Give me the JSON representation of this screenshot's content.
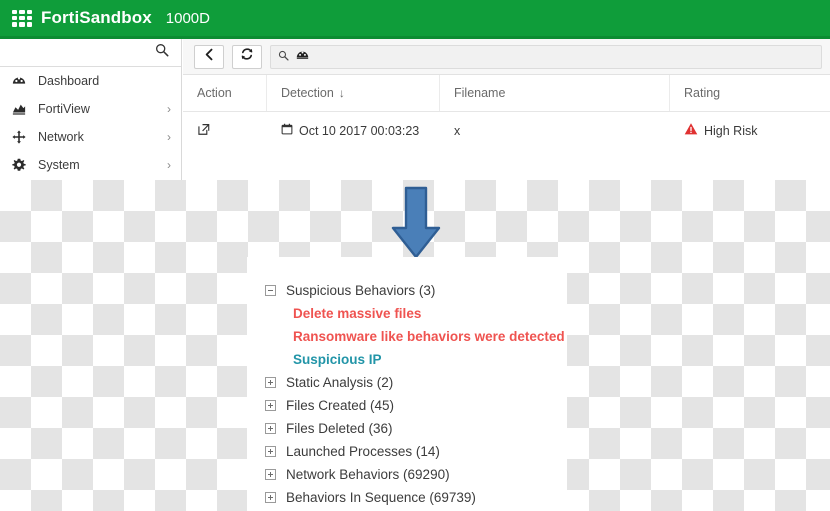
{
  "header": {
    "brand": "FortiSandbox",
    "model": "1000D",
    "logo_icon": "grid-logo-icon",
    "bg_color": "#0f9d3a"
  },
  "sidebar": {
    "search_icon": "search-icon",
    "items": [
      {
        "label": "Dashboard",
        "icon": "dashboard-gauge-icon",
        "chevron": ""
      },
      {
        "label": "FortiView",
        "icon": "area-chart-icon",
        "chevron": "›"
      },
      {
        "label": "Network",
        "icon": "move-arrows-icon",
        "chevron": "›"
      },
      {
        "label": "System",
        "icon": "gear-icon",
        "chevron": "›"
      }
    ]
  },
  "toolbar": {
    "back_icon": "chevron-left-icon",
    "refresh_icon": "refresh-icon",
    "search_icon": "search-icon",
    "filter_icon": "dashboard-gauge-icon",
    "search_value": "",
    "search_placeholder": ""
  },
  "table": {
    "columns": [
      {
        "key": "action",
        "label": "Action"
      },
      {
        "key": "detection",
        "label": "Detection",
        "sort": "↓"
      },
      {
        "key": "filename",
        "label": "Filename"
      },
      {
        "key": "rating",
        "label": "Rating"
      }
    ],
    "rows": [
      {
        "action_icon": "external-link-icon",
        "detection_icon": "calendar-icon",
        "detection": "Oct 10 2017 00:03:23",
        "filename": "x",
        "rating_icon": "warning-triangle-icon",
        "rating": "High Risk",
        "rating_color": "#e03131"
      }
    ]
  },
  "annotation": {
    "arrow_icon": "down-arrow-icon",
    "arrow_fill": "#4a7fb8",
    "arrow_stroke": "#2f5e94"
  },
  "detail_tree": {
    "nodes": [
      {
        "label": "Suspicious Behaviors (3)",
        "state": "expanded",
        "children": [
          {
            "label": "Delete massive files",
            "color": "#ef5350"
          },
          {
            "label": "Ransomware like behaviors were detected",
            "color": "#ef5350"
          },
          {
            "label": "Suspicious IP",
            "color": "#2295a8"
          }
        ]
      },
      {
        "label": "Static Analysis (2)",
        "state": "collapsed",
        "children": []
      },
      {
        "label": "Files Created (45)",
        "state": "collapsed",
        "children": []
      },
      {
        "label": "Files Deleted (36)",
        "state": "collapsed",
        "children": []
      },
      {
        "label": "Launched Processes (14)",
        "state": "collapsed",
        "children": []
      },
      {
        "label": "Network Behaviors (69290)",
        "state": "collapsed",
        "children": []
      },
      {
        "label": "Behaviors In Sequence (69739)",
        "state": "collapsed",
        "children": []
      }
    ]
  }
}
